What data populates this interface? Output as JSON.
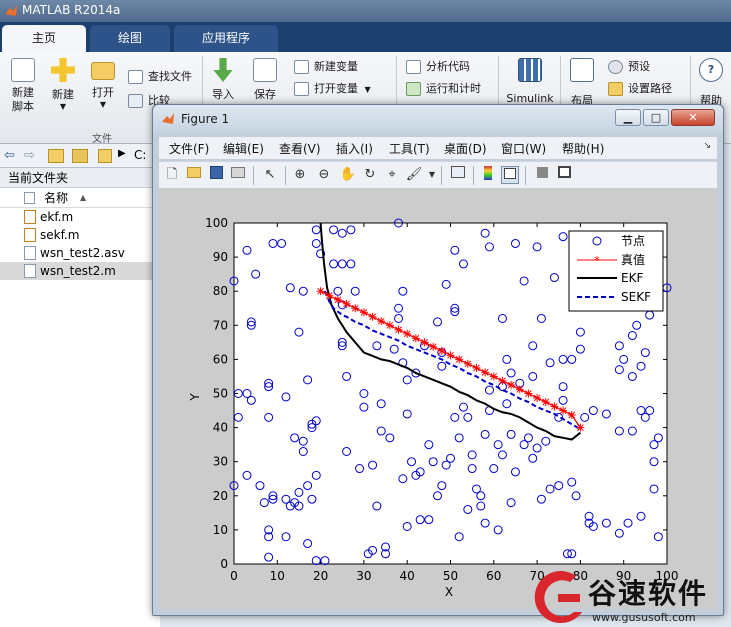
{
  "app": {
    "title": "MATLAB R2014a"
  },
  "tabs": [
    "主页",
    "绘图",
    "应用程序"
  ],
  "ribbon": {
    "new_script": "新建\n脚本",
    "new": "新建",
    "open": "打开",
    "find_files": "查找文件",
    "compare": "比较",
    "import": "导入",
    "save": "保存",
    "new_variable": "新建变量",
    "open_variable": "打开变量",
    "analyze_code": "分析代码",
    "run_and_time": "运行和计时",
    "simulink": "Simulink",
    "layout": "布局",
    "preferences": "预设",
    "set_path": "设置路径",
    "help": "帮助",
    "group_file": "文件"
  },
  "path": {
    "drive": "C:"
  },
  "current_folder": {
    "title": "当前文件夹",
    "name_col": "名称",
    "files": [
      "ekf.m",
      "sekf.m",
      "wsn_test2.asv",
      "wsn_test2.m"
    ]
  },
  "figure": {
    "title": "Figure 1",
    "menu": [
      "文件(F)",
      "编辑(E)",
      "查看(V)",
      "插入(I)",
      "工具(T)",
      "桌面(D)",
      "窗口(W)",
      "帮助(H)"
    ],
    "minimize": "▁",
    "maximize": "□",
    "close": "✕"
  },
  "colors": {
    "nodes": "#0000cc",
    "true": "#ff0000",
    "ekf": "#000000",
    "sekf": "#0000cc",
    "matlab_blue": "#1d3f6e"
  },
  "chart_data": {
    "type": "scatter",
    "xlabel": "X",
    "ylabel": "Y",
    "xlim": [
      0,
      100
    ],
    "ylim": [
      0,
      100
    ],
    "xticks": [
      0,
      10,
      20,
      30,
      40,
      50,
      60,
      70,
      80,
      90,
      100
    ],
    "yticks": [
      0,
      10,
      20,
      30,
      40,
      50,
      60,
      70,
      80,
      90,
      100
    ],
    "legend_position": "top-right",
    "series": [
      {
        "name": "节点",
        "type": "scatter",
        "marker": "circle",
        "points": [
          [
            0,
            83
          ],
          [
            0,
            23
          ],
          [
            1,
            43
          ],
          [
            1,
            50
          ],
          [
            3,
            26
          ],
          [
            3,
            92
          ],
          [
            3,
            50
          ],
          [
            4,
            71
          ],
          [
            4,
            70
          ],
          [
            4,
            48
          ],
          [
            5,
            85
          ],
          [
            6,
            23
          ],
          [
            7,
            18
          ],
          [
            8,
            43
          ],
          [
            8,
            52
          ],
          [
            8,
            53
          ],
          [
            8,
            10
          ],
          [
            8,
            8
          ],
          [
            8,
            2
          ],
          [
            9,
            94
          ],
          [
            9,
            19
          ],
          [
            9,
            20
          ],
          [
            11,
            94
          ],
          [
            12,
            49
          ],
          [
            12,
            8
          ],
          [
            12,
            19
          ],
          [
            13,
            17
          ],
          [
            13,
            81
          ],
          [
            14,
            18
          ],
          [
            14,
            37
          ],
          [
            15,
            68
          ],
          [
            15,
            21
          ],
          [
            15,
            17
          ],
          [
            16,
            80
          ],
          [
            16,
            36
          ],
          [
            16,
            33
          ],
          [
            17,
            23
          ],
          [
            17,
            54
          ],
          [
            17,
            6
          ],
          [
            18,
            19
          ],
          [
            18,
            41
          ],
          [
            18,
            40
          ],
          [
            19,
            42
          ],
          [
            19,
            26
          ],
          [
            19,
            1
          ],
          [
            19,
            98
          ],
          [
            19,
            94
          ],
          [
            20,
            91
          ],
          [
            21,
            1
          ],
          [
            23,
            98
          ],
          [
            23,
            88
          ],
          [
            24,
            80
          ],
          [
            25,
            97
          ],
          [
            25,
            88
          ],
          [
            25,
            76
          ],
          [
            25,
            64
          ],
          [
            25,
            65
          ],
          [
            26,
            55
          ],
          [
            26,
            33
          ],
          [
            27,
            98
          ],
          [
            27,
            88
          ],
          [
            28,
            80
          ],
          [
            29,
            28
          ],
          [
            30,
            50
          ],
          [
            30,
            46
          ],
          [
            31,
            3
          ],
          [
            32,
            4
          ],
          [
            32,
            29
          ],
          [
            33,
            17
          ],
          [
            33,
            64
          ],
          [
            34,
            47
          ],
          [
            34,
            39
          ],
          [
            35,
            5
          ],
          [
            35,
            3
          ],
          [
            36,
            37
          ],
          [
            37,
            63
          ],
          [
            38,
            72
          ],
          [
            38,
            100
          ],
          [
            38,
            75
          ],
          [
            39,
            59
          ],
          [
            39,
            80
          ],
          [
            39,
            25
          ],
          [
            40,
            54
          ],
          [
            40,
            11
          ],
          [
            40,
            44
          ],
          [
            41,
            30
          ],
          [
            42,
            26
          ],
          [
            42,
            56
          ],
          [
            43,
            13
          ],
          [
            43,
            27
          ],
          [
            44,
            64
          ],
          [
            45,
            13
          ],
          [
            45,
            35
          ],
          [
            46,
            30
          ],
          [
            47,
            71
          ],
          [
            47,
            20
          ],
          [
            48,
            58
          ],
          [
            48,
            62
          ],
          [
            48,
            23
          ],
          [
            49,
            82
          ],
          [
            49,
            29
          ],
          [
            50,
            31
          ],
          [
            51,
            74
          ],
          [
            51,
            75
          ],
          [
            51,
            92
          ],
          [
            51,
            43
          ],
          [
            52,
            8
          ],
          [
            52,
            37
          ],
          [
            53,
            88
          ],
          [
            53,
            46
          ],
          [
            54,
            16
          ],
          [
            54,
            43
          ],
          [
            55,
            32
          ],
          [
            55,
            28
          ],
          [
            56,
            22
          ],
          [
            57,
            20
          ],
          [
            57,
            17
          ],
          [
            58,
            38
          ],
          [
            58,
            12
          ],
          [
            58,
            97
          ],
          [
            59,
            93
          ],
          [
            59,
            51
          ],
          [
            59,
            45
          ],
          [
            60,
            28
          ],
          [
            61,
            35
          ],
          [
            61,
            10
          ],
          [
            62,
            32
          ],
          [
            62,
            72
          ],
          [
            62,
            52
          ],
          [
            63,
            60
          ],
          [
            63,
            47
          ],
          [
            64,
            56
          ],
          [
            64,
            38
          ],
          [
            64,
            18
          ],
          [
            65,
            94
          ],
          [
            65,
            27
          ],
          [
            66,
            53
          ],
          [
            67,
            35
          ],
          [
            67,
            83
          ],
          [
            68,
            37
          ],
          [
            69,
            55
          ],
          [
            69,
            64
          ],
          [
            69,
            31
          ],
          [
            70,
            93
          ],
          [
            70,
            34
          ],
          [
            71,
            72
          ],
          [
            71,
            19
          ],
          [
            72,
            36
          ],
          [
            73,
            59
          ],
          [
            73,
            22
          ],
          [
            74,
            84
          ],
          [
            75,
            43
          ],
          [
            75,
            23
          ],
          [
            76,
            60
          ],
          [
            76,
            52
          ],
          [
            76,
            48
          ],
          [
            76,
            96
          ],
          [
            77,
            3
          ],
          [
            78,
            60
          ],
          [
            78,
            3
          ],
          [
            78,
            24
          ],
          [
            79,
            88
          ],
          [
            79,
            20
          ],
          [
            80,
            68
          ],
          [
            80,
            63
          ],
          [
            81,
            43
          ],
          [
            82,
            14
          ],
          [
            82,
            12
          ],
          [
            83,
            45
          ],
          [
            83,
            11
          ],
          [
            84,
            81
          ],
          [
            86,
            12
          ],
          [
            86,
            44
          ],
          [
            87,
            81
          ],
          [
            89,
            57
          ],
          [
            89,
            64
          ],
          [
            89,
            9
          ],
          [
            89,
            39
          ],
          [
            90,
            60
          ],
          [
            91,
            12
          ],
          [
            92,
            67
          ],
          [
            92,
            39
          ],
          [
            92,
            55
          ],
          [
            93,
            70
          ],
          [
            94,
            58
          ],
          [
            94,
            14
          ],
          [
            94,
            45
          ],
          [
            95,
            62
          ],
          [
            95,
            43
          ],
          [
            96,
            45
          ],
          [
            96,
            73
          ],
          [
            97,
            22
          ],
          [
            97,
            30
          ],
          [
            97,
            35
          ],
          [
            98,
            37
          ],
          [
            98,
            8
          ],
          [
            100,
            81
          ]
        ]
      },
      {
        "name": "真值",
        "type": "line",
        "marker": "star",
        "x": [
          20,
          22,
          24,
          26,
          28,
          30,
          32,
          34,
          36,
          38,
          40,
          42,
          44,
          46,
          48,
          50,
          52,
          54,
          56,
          58,
          60,
          62,
          64,
          66,
          68,
          70,
          72,
          74,
          76,
          78,
          80
        ],
        "y": [
          80,
          78.7,
          77.5,
          76.3,
          75,
          73.8,
          72.5,
          71.2,
          70,
          68.7,
          67.5,
          66.2,
          65,
          63.7,
          62.5,
          61.2,
          60,
          58.7,
          57.5,
          56.2,
          55,
          53.7,
          52.5,
          51.2,
          50,
          48.7,
          47.5,
          46.2,
          45,
          43.7,
          40
        ]
      },
      {
        "name": "EKF",
        "type": "line",
        "x": [
          20,
          20.3,
          20.8,
          21.5,
          22.5,
          24,
          26,
          28,
          30,
          32,
          34,
          36,
          38,
          40,
          42,
          44,
          46,
          48,
          50,
          52,
          54,
          56,
          58,
          60,
          62,
          64,
          66,
          68,
          70,
          72,
          74,
          76,
          78,
          80
        ],
        "y": [
          100,
          95,
          88,
          81,
          76,
          72,
          68,
          65,
          62,
          61,
          60,
          59.5,
          58.5,
          57.5,
          56,
          55,
          54,
          53,
          52,
          50.5,
          49.5,
          48,
          47,
          45.5,
          44.5,
          44,
          43,
          41.5,
          40,
          39,
          37.5,
          37,
          36.5,
          38.5
        ]
      },
      {
        "name": "SEKF",
        "type": "line",
        "dash": "dashed",
        "x": [
          21,
          22,
          23,
          24,
          25,
          26,
          28,
          30,
          32,
          34,
          36,
          38,
          40,
          42,
          44,
          46,
          48,
          50,
          52,
          54,
          56,
          58,
          60,
          62,
          64,
          66,
          68,
          70,
          72,
          74,
          76,
          78,
          80
        ],
        "y": [
          80,
          77,
          75,
          74,
          73,
          72.5,
          71,
          70,
          68.5,
          67.5,
          66.5,
          65.5,
          64,
          63,
          62,
          61,
          60,
          58.5,
          57.5,
          56,
          55,
          53.5,
          52.5,
          51,
          50,
          48.5,
          47.5,
          46,
          45,
          44,
          42.5,
          41,
          39.5
        ]
      }
    ]
  },
  "watermark": {
    "brand": "谷速软件",
    "url": "www.gususoft.com"
  }
}
